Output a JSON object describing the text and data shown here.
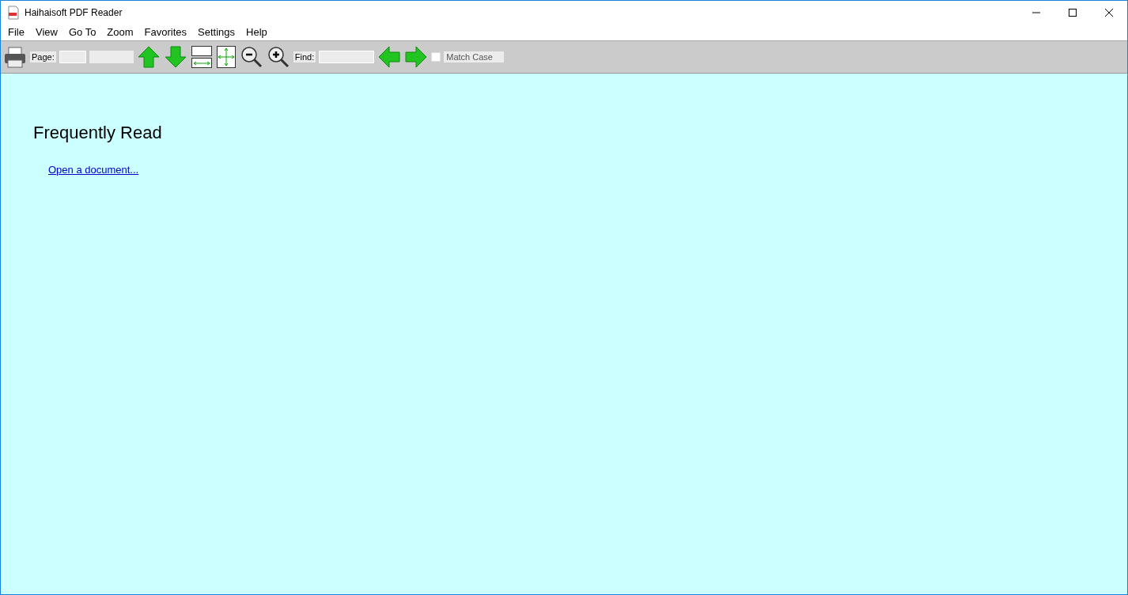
{
  "window": {
    "title": "Haihaisoft PDF Reader"
  },
  "menu": [
    "File",
    "View",
    "Go To",
    "Zoom",
    "Favorites",
    "Settings",
    "Help"
  ],
  "toolbar": {
    "page_label": "Page:",
    "find_label": "Find:",
    "match_case": {
      "label": "Match Case",
      "checked": false
    }
  },
  "content": {
    "heading": "Frequently Read",
    "link": "Open a document..."
  }
}
